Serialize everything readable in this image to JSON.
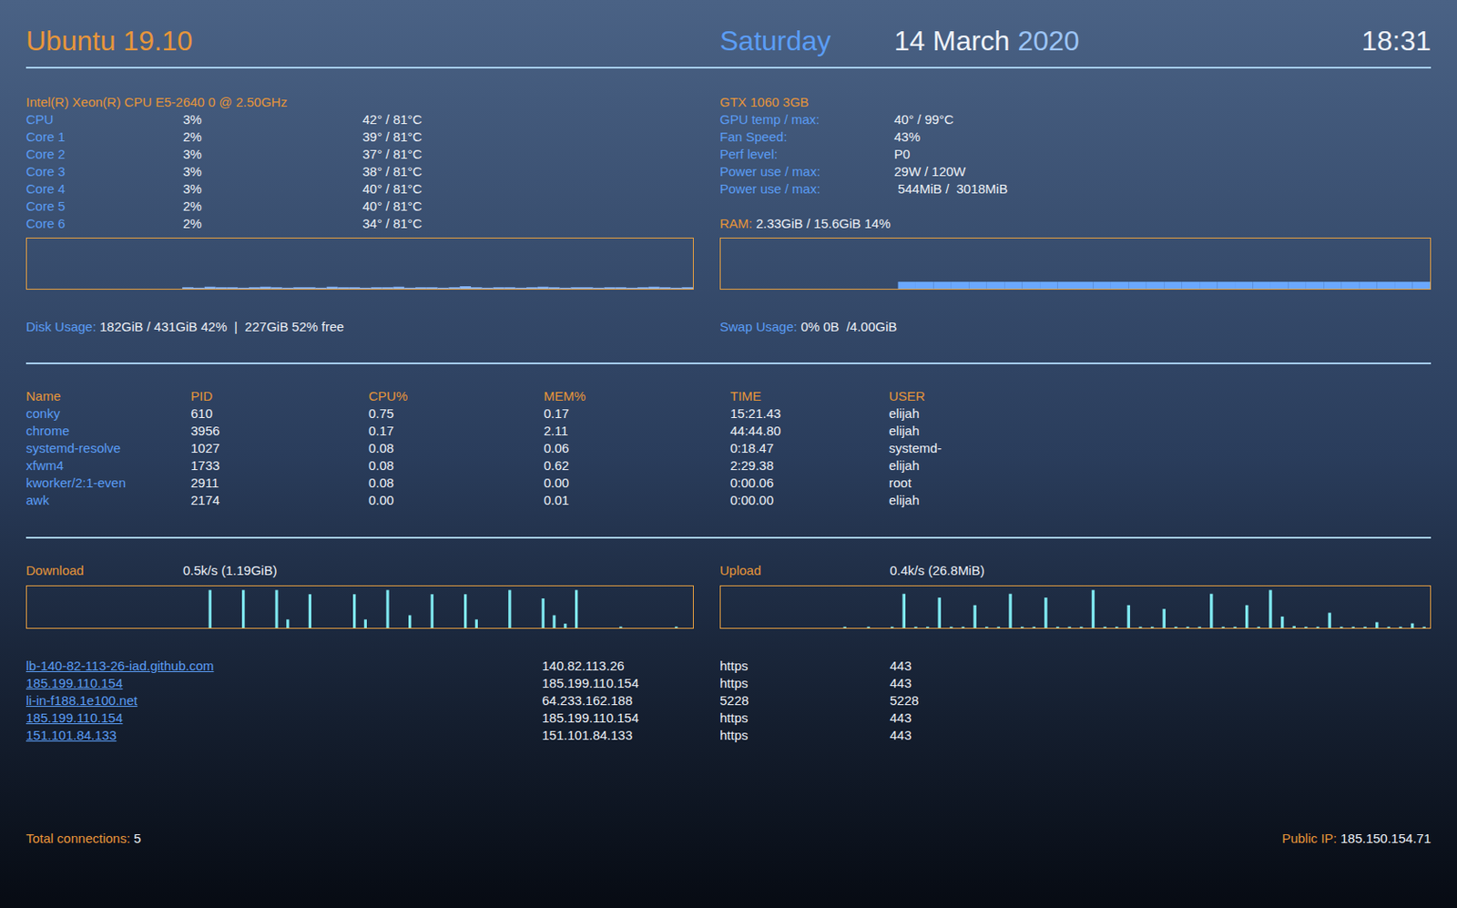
{
  "header": {
    "os": "Ubuntu 19.10",
    "day": "Saturday",
    "date": "14 March",
    "year": "2020",
    "time": "18:31"
  },
  "cpu": {
    "model": "Intel(R) Xeon(R) CPU E5-2640 0 @ 2.50GHz",
    "rows": [
      {
        "label": "CPU",
        "usage": "3%",
        "temp": "42° / 81°C"
      },
      {
        "label": "Core 1",
        "usage": "2%",
        "temp": "39° / 81°C"
      },
      {
        "label": "Core 2",
        "usage": "3%",
        "temp": "37° / 81°C"
      },
      {
        "label": "Core 3",
        "usage": "3%",
        "temp": "38° / 81°C"
      },
      {
        "label": "Core 4",
        "usage": "3%",
        "temp": "40° / 81°C"
      },
      {
        "label": "Core 5",
        "usage": "2%",
        "temp": "40° / 81°C"
      },
      {
        "label": "Core 6",
        "usage": "2%",
        "temp": "34° / 81°C"
      }
    ],
    "graph": [
      0,
      0,
      0,
      0,
      0,
      0,
      0,
      0,
      0,
      0,
      0,
      0,
      0,
      0,
      3,
      2,
      4,
      3,
      3,
      2,
      3,
      4,
      3,
      2,
      3,
      3,
      2,
      4,
      3,
      3,
      2,
      3,
      3,
      4,
      2,
      3,
      3,
      2,
      3,
      5,
      3,
      2,
      3,
      3,
      2,
      3,
      4,
      3,
      2,
      3,
      3,
      2,
      3,
      3,
      2,
      3,
      4,
      3,
      2,
      3
    ]
  },
  "gpu": {
    "model": "GTX 1060 3GB",
    "rows": [
      {
        "label": "GPU temp / max:",
        "value": "40° / 99°C"
      },
      {
        "label": "Fan Speed:",
        "value": "43%"
      },
      {
        "label": "Perf level:",
        "value": "P0"
      },
      {
        "label": "Power use / max:",
        "value": "29W / 120W"
      },
      {
        "label": "Power use / max:",
        "value": " 544MiB /  3018MiB"
      }
    ]
  },
  "ram": {
    "label": "RAM:",
    "value": "2.33GiB / 15.6GiB 14%",
    "graph": [
      0,
      0,
      0,
      0,
      0,
      0,
      0,
      0,
      0,
      0,
      14,
      14,
      14,
      14,
      14,
      14,
      14,
      14,
      14,
      14,
      14,
      14,
      14,
      14,
      14,
      14,
      14,
      14,
      14,
      14,
      14,
      14,
      14,
      14,
      14,
      14,
      14,
      14,
      14,
      14
    ]
  },
  "disk": {
    "label": "Disk Usage:",
    "value": "182GiB / 431GiB 42%  |  227GiB 52% free"
  },
  "swap": {
    "label": "Swap Usage:",
    "value": "0% 0B  /4.00GiB"
  },
  "processes": {
    "columns": [
      "Name",
      "PID",
      "CPU%",
      "MEM%",
      "TIME",
      "USER"
    ],
    "rows": [
      [
        "conky",
        "610",
        "0.75",
        "0.17",
        "15:21.43",
        "elijah"
      ],
      [
        "chrome",
        "3956",
        "0.17",
        "2.11",
        "44:44.80",
        "elijah"
      ],
      [
        "systemd-resolve",
        "1027",
        "0.08",
        "0.06",
        "0:18.47",
        "systemd-"
      ],
      [
        "xfwm4",
        "1733",
        "0.08",
        "0.62",
        "2:29.38",
        "elijah"
      ],
      [
        "kworker/2:1-even",
        "2911",
        "0.08",
        "0.00",
        "0:00.06",
        "root"
      ],
      [
        "awk",
        "2174",
        "0.00",
        "0.01",
        "0:00.00",
        "elijah"
      ]
    ]
  },
  "network": {
    "download": {
      "label": "Download",
      "value": "0.5k/s (1.19GiB)",
      "graph": [
        0,
        0,
        0,
        0,
        0,
        0,
        0,
        0,
        0,
        0,
        0,
        0,
        0,
        0,
        0,
        0,
        9,
        0,
        0,
        9,
        0,
        0,
        9,
        2,
        0,
        8,
        0,
        0,
        0,
        8,
        2,
        0,
        9,
        0,
        3,
        0,
        8,
        0,
        0,
        8,
        2,
        0,
        0,
        9,
        0,
        0,
        7,
        3,
        1,
        9,
        0,
        0,
        0,
        0.3,
        0,
        0,
        0,
        0,
        0.3,
        0
      ]
    },
    "upload": {
      "label": "Upload",
      "value": "0.4k/s (26.8MiB)",
      "graph": [
        0,
        0,
        0,
        0,
        0,
        0,
        0,
        0,
        0,
        0,
        0.3,
        0,
        0.3,
        0,
        0.3,
        9,
        0.3,
        0.3,
        8,
        0.3,
        0.3,
        6,
        0.3,
        0.3,
        9,
        0.3,
        0.3,
        8,
        0.3,
        0.3,
        0.3,
        10,
        0.3,
        0.3,
        6,
        0.3,
        0.3,
        5,
        0.3,
        0.3,
        0.3,
        9,
        0.3,
        0.3,
        6,
        0.3,
        10,
        3,
        0.5,
        0.3,
        0.3,
        4,
        0.3,
        0.3,
        0.3,
        1.5,
        0.3,
        0.3,
        1.2,
        0.3
      ]
    }
  },
  "connections": [
    {
      "host": "lb-140-82-113-26-iad.github.com",
      "ip": "140.82.113.26",
      "service": "https",
      "port": "443"
    },
    {
      "host": "185.199.110.154",
      "ip": "185.199.110.154",
      "service": "https",
      "port": "443"
    },
    {
      "host": "li-in-f188.1e100.net",
      "ip": "64.233.162.188",
      "service": "5228",
      "port": "5228"
    },
    {
      "host": "185.199.110.154",
      "ip": "185.199.110.154",
      "service": "https",
      "port": "443"
    },
    {
      "host": "151.101.84.133",
      "ip": "151.101.84.133",
      "service": "https",
      "port": "443"
    }
  ],
  "footer": {
    "connections_label": "Total connections:",
    "connections_value": "5",
    "ip_label": "Public IP:",
    "ip_value": "185.150.154.71"
  }
}
